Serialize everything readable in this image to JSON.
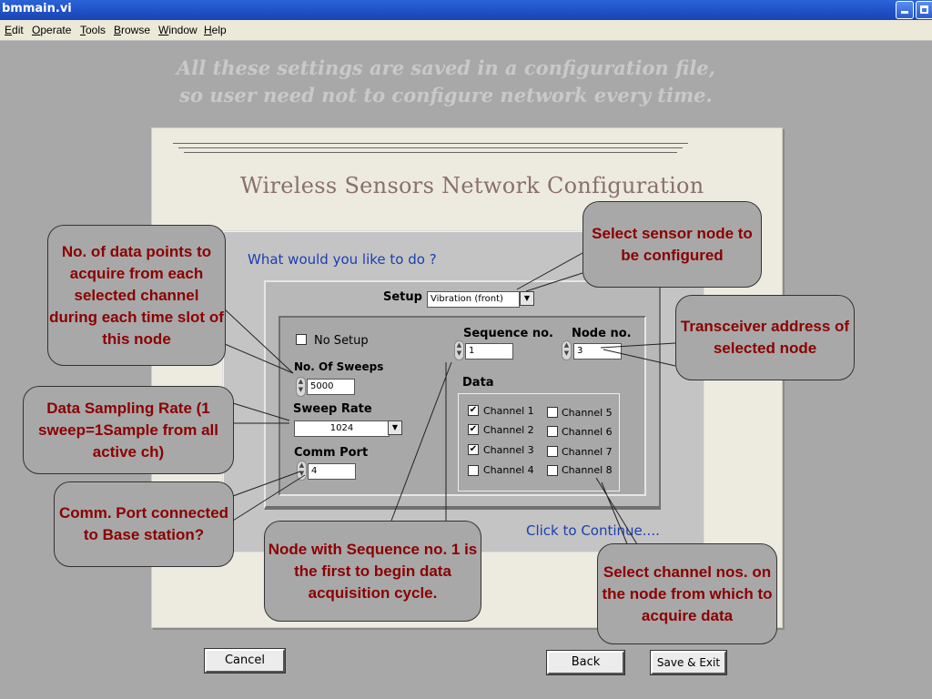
{
  "window": {
    "title": "bmmain.vi"
  },
  "menu": [
    "Edit",
    "Operate",
    "Tools",
    "Browse",
    "Window",
    "Help"
  ],
  "heading": {
    "line1": "All these settings are saved in a configuration file,",
    "line2": "so user need not to configure network every time."
  },
  "panel": {
    "title": "Wireless Sensors Network Configuration",
    "question": "What would you like to do ?",
    "setup_label": "Setup",
    "setup_value": "Vibration (front)",
    "no_setup_label": "No Setup",
    "no_sweeps_label": "No. Of Sweeps",
    "no_sweeps_value": "5000",
    "sweep_rate_label": "Sweep Rate",
    "sweep_rate_value": "1024",
    "comm_port_label": "Comm Port",
    "comm_port_value": "4",
    "sequence_label": "Sequence no.",
    "sequence_value": "1",
    "node_label": "Node no.",
    "node_value": "3",
    "data_label": "Data",
    "channels": [
      {
        "label": "Channel 1",
        "checked": true
      },
      {
        "label": "Channel 2",
        "checked": true
      },
      {
        "label": "Channel 3",
        "checked": true
      },
      {
        "label": "Channel 4",
        "checked": false
      },
      {
        "label": "Channel 5",
        "checked": false
      },
      {
        "label": "Channel 6",
        "checked": false
      },
      {
        "label": "Channel 7",
        "checked": false
      },
      {
        "label": "Channel 8",
        "checked": false
      }
    ],
    "continue_label": "Click to Continue...."
  },
  "buttons": {
    "cancel": "Cancel",
    "back": "Back",
    "save_exit": "Save & Exit"
  },
  "callouts": {
    "sweeps": "No. of data points to acquire from each selected channel during each time slot of this node",
    "sweep_rate": "Data Sampling Rate (1 sweep=1Sample from all active ch)",
    "comm_port": "Comm. Port connected to Base station?",
    "sequence": "Node with Sequence no. 1 is the first to begin data acquisition cycle.",
    "sensor": "Select sensor node to be configured",
    "transceiver": "Transceiver address of selected node",
    "channels": "Select channel nos. on the node from which to acquire data"
  },
  "colors": {
    "titlebar": "#2b63d8",
    "callout_text": "#8b0000",
    "link_blue": "#1a3fb0"
  }
}
